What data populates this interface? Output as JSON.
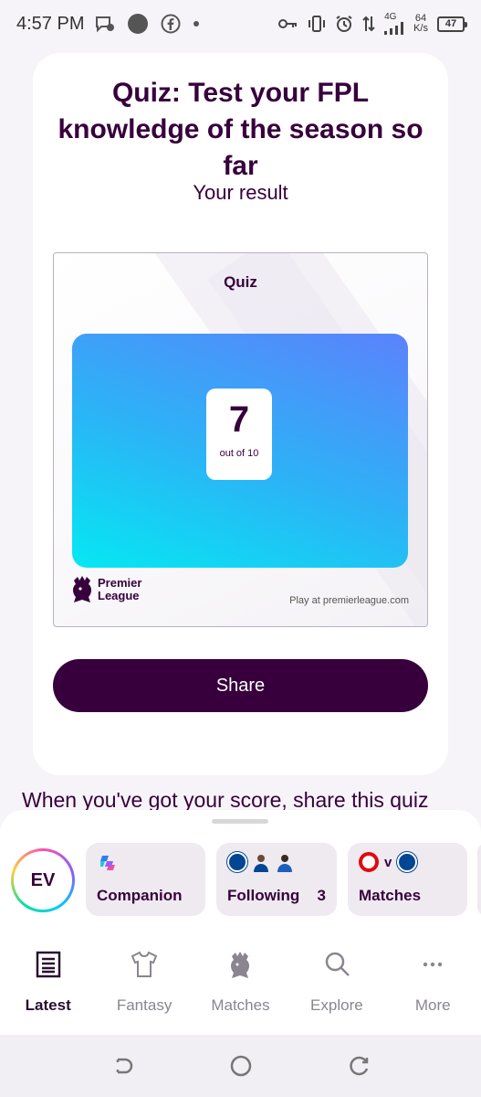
{
  "status_bar": {
    "time": "4:57 PM",
    "network_type": "4G",
    "net_speed_value": "64",
    "net_speed_unit": "K/s",
    "battery": "47"
  },
  "result": {
    "title": "Quiz: Test your FPL knowledge of the season so far",
    "subtitle": "Your result",
    "card_label": "Quiz",
    "score": "7",
    "score_suffix": "out of 10",
    "brand_line1": "Premier",
    "brand_line2": "League",
    "play_at": "Play at premierleague.com",
    "share_label": "Share"
  },
  "below_text": "When you've got your score, share this quiz",
  "sheet": {
    "avatar_initials": "EV",
    "chips": [
      {
        "label": "Companion"
      },
      {
        "label": "Following",
        "count": "3"
      },
      {
        "label": "Matches",
        "versus": "v"
      }
    ]
  },
  "bottom_nav": {
    "items": [
      {
        "label": "Latest",
        "icon": "latest-icon",
        "active": true
      },
      {
        "label": "Fantasy",
        "icon": "shirt-icon"
      },
      {
        "label": "Matches",
        "icon": "lion-icon"
      },
      {
        "label": "Explore",
        "icon": "search-icon"
      },
      {
        "label": "More",
        "icon": "more-dots-icon"
      }
    ]
  },
  "colors": {
    "brand_purple": "#37003c",
    "gradient_start": "#05e8f2",
    "gradient_end": "#5b82fc"
  }
}
